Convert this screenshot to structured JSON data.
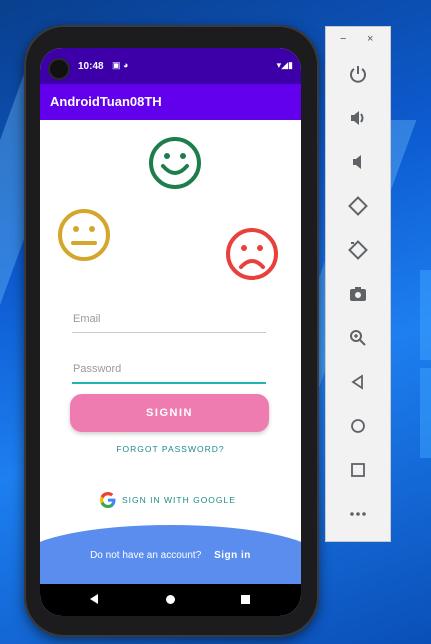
{
  "status_bar": {
    "time": "10:48",
    "icons_left": "▣ ◕",
    "icons_right": "▾◢▮"
  },
  "app_bar": {
    "title": "AndroidTuan08TH"
  },
  "form": {
    "email_placeholder": "Email",
    "password_placeholder": "Password",
    "signin_label": "SIGNIN",
    "forgot_label": "FORGOT PASSWORD?",
    "google_label": "SIGN  IN WITH GOOGLE"
  },
  "footer": {
    "prompt": "Do not have an account?",
    "signin_link": "Sign in"
  },
  "faces": [
    {
      "name": "happy",
      "color": "#1e7d4c"
    },
    {
      "name": "neutral",
      "color": "#d4a72c"
    },
    {
      "name": "sad",
      "color": "#e8403a"
    }
  ],
  "emulator_panel": {
    "minimize": "−",
    "close": "×",
    "buttons": [
      "power-icon",
      "volume-up-icon",
      "volume-down-icon",
      "rotate-left-icon",
      "rotate-right-icon",
      "camera-icon",
      "zoom-icon",
      "back-icon",
      "home-icon",
      "overview-icon",
      "more-icon"
    ]
  },
  "colors": {
    "status_bar": "#3d00a8",
    "app_bar": "#6200ee",
    "signin_button": "#ef7cb0",
    "accent_text": "#1f8a8a",
    "bottom_wave": "#5b8def"
  }
}
